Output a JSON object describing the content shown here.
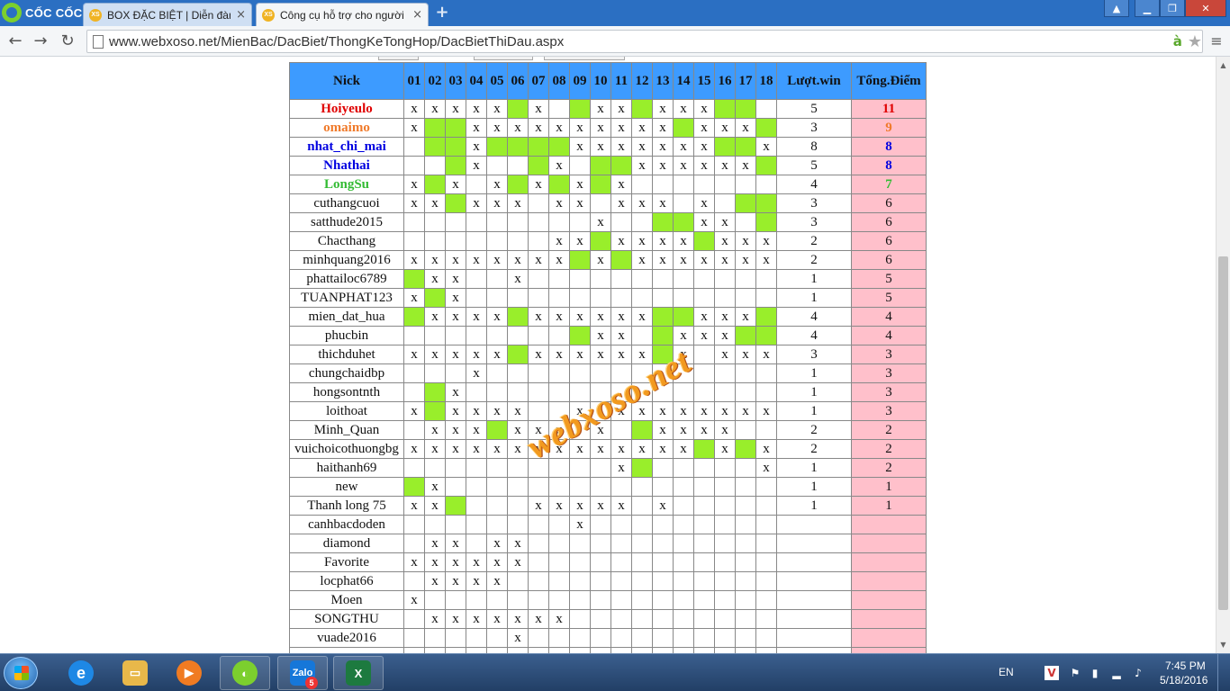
{
  "browser": {
    "brand": "CỐC CỐC",
    "tabs": [
      {
        "title": "BOX ĐẶC BIỆT | Diễn đàn x",
        "favicon": "XS"
      },
      {
        "title": "Công cụ hỗ trợ cho người",
        "favicon": "XS"
      }
    ],
    "url": "www.webxoso.net/MienBac/DacBiet/ThongKeTongHop/DacBietThiDau.aspx",
    "address_icons": {
      "ext": "à"
    }
  },
  "table": {
    "nick_header": "Nick",
    "day_headers": [
      "01",
      "02",
      "03",
      "04",
      "05",
      "06",
      "07",
      "08",
      "09",
      "10",
      "11",
      "12",
      "13",
      "14",
      "15",
      "16",
      "17",
      "18"
    ],
    "wins_header": "Lượt.win",
    "points_header": "Tổng.Điểm",
    "rows": [
      {
        "nick": "Hoiyeulo",
        "color": "#e00000",
        "days": "xxxxgxgxxgxxxgg",
        "wins": "5",
        "points": "11"
      },
      {
        "nick": "omaimo",
        "color": "#f07a2a",
        "days": "xggxxxxxxxxxgxxxg",
        "wins": "3",
        "points": "9"
      },
      {
        "nick": "nhat_chi_mai",
        "color": "#0000e0",
        "days": "gggxggggxxxxxxggggx",
        "wins": "8",
        "points": "8"
      },
      {
        "nick": "Nhathai",
        "color": "#0000e0",
        "days": "",
        "wins": "5",
        "points": "8"
      },
      {
        "nick": "LongSu",
        "color": "#33bb33",
        "days": "",
        "wins": "4",
        "points": "7"
      },
      {
        "nick": "cuthangcuoi",
        "color": "",
        "days": "",
        "wins": "3",
        "points": "6"
      },
      {
        "nick": "satthude2015",
        "color": "",
        "days": "",
        "wins": "3",
        "points": "6"
      },
      {
        "nick": "Chacthang",
        "color": "",
        "days": "",
        "wins": "2",
        "points": "6"
      },
      {
        "nick": "minhquang2016",
        "color": "",
        "days": "",
        "wins": "2",
        "points": "6"
      },
      {
        "nick": "phattailoc6789",
        "color": "",
        "days": "",
        "wins": "1",
        "points": "5"
      },
      {
        "nick": "TUANPHAT123",
        "color": "",
        "days": "",
        "wins": "1",
        "points": "5"
      },
      {
        "nick": "mien_dat_hua",
        "color": "",
        "days": "",
        "wins": "4",
        "points": "4"
      },
      {
        "nick": "phucbin",
        "color": "",
        "days": "",
        "wins": "4",
        "points": "4"
      },
      {
        "nick": "thichduhet",
        "color": "",
        "days": "",
        "wins": "3",
        "points": "3"
      },
      {
        "nick": "chungchaidbp",
        "color": "",
        "days": "",
        "wins": "1",
        "points": "3"
      },
      {
        "nick": "hongsontnth",
        "color": "",
        "days": "",
        "wins": "1",
        "points": "3"
      },
      {
        "nick": "loithoat",
        "color": "",
        "days": "",
        "wins": "1",
        "points": "3"
      },
      {
        "nick": "Minh_Quan",
        "color": "",
        "days": "",
        "wins": "2",
        "points": "2"
      },
      {
        "nick": "vuichoicothuongbg",
        "color": "",
        "days": "",
        "wins": "2",
        "points": "2"
      },
      {
        "nick": "haithanh69",
        "color": "",
        "days": "",
        "wins": "1",
        "points": "2"
      },
      {
        "nick": "new",
        "color": "",
        "days": "",
        "wins": "1",
        "points": "1"
      },
      {
        "nick": "Thanh long 75",
        "color": "",
        "days": "",
        "wins": "1",
        "points": "1"
      },
      {
        "nick": "canhbacdoden",
        "color": "",
        "days": "",
        "wins": "",
        "points": ""
      },
      {
        "nick": "diamond",
        "color": "",
        "days": "",
        "wins": "",
        "points": ""
      },
      {
        "nick": "Favorite",
        "color": "",
        "days": "",
        "wins": "",
        "points": ""
      },
      {
        "nick": "locphat66",
        "color": "",
        "days": "",
        "wins": "",
        "points": ""
      },
      {
        "nick": "Moen",
        "color": "",
        "days": "",
        "wins": "",
        "points": ""
      },
      {
        "nick": "SONGTHU",
        "color": "",
        "days": "",
        "wins": "",
        "points": ""
      },
      {
        "nick": "vuade2016",
        "color": "",
        "days": "",
        "wins": "",
        "points": ""
      }
    ],
    "cells": [
      [
        "x",
        "x",
        "x",
        "x",
        "x",
        "g",
        "x",
        "",
        "g",
        "x",
        "x",
        "g",
        "x",
        "x",
        "x",
        "g",
        "g",
        ""
      ],
      [
        "x",
        "g",
        "g",
        "x",
        "x",
        "x",
        "x",
        "x",
        "x",
        "x",
        "x",
        "x",
        "x",
        "g",
        "x",
        "x",
        "x",
        "g"
      ],
      [
        "",
        "g",
        "g",
        "x",
        "g",
        "g",
        "g",
        "g",
        "x",
        "x",
        "x",
        "x",
        "x",
        "x",
        "x",
        "g",
        "g",
        "x"
      ],
      [
        "",
        "",
        "g",
        "x",
        "",
        "",
        "g",
        "x",
        "",
        "g",
        "g",
        "x",
        "x",
        "x",
        "x",
        "x",
        "x",
        "g"
      ],
      [
        "x",
        "g",
        "x",
        "",
        "x",
        "g",
        "x",
        "g",
        "x",
        "g",
        "x",
        "",
        "",
        "",
        "",
        "",
        "",
        ""
      ],
      [
        "x",
        "x",
        "g",
        "x",
        "x",
        "x",
        "",
        "x",
        "x",
        "",
        "x",
        "x",
        "x",
        "",
        "x",
        "",
        "g",
        "g"
      ],
      [
        "",
        "",
        "",
        "",
        "",
        "",
        "",
        "",
        "",
        "x",
        "",
        "",
        "g",
        "g",
        "x",
        "x",
        "",
        "g"
      ],
      [
        "",
        "",
        "",
        "",
        "",
        "",
        "",
        "x",
        "x",
        "g",
        "x",
        "x",
        "x",
        "x",
        "g",
        "x",
        "x",
        "x"
      ],
      [
        "x",
        "x",
        "x",
        "x",
        "x",
        "x",
        "x",
        "x",
        "g",
        "x",
        "g",
        "x",
        "x",
        "x",
        "x",
        "x",
        "x",
        "x"
      ],
      [
        "g",
        "x",
        "x",
        "",
        "",
        "x",
        "",
        "",
        "",
        "",
        "",
        "",
        "",
        "",
        "",
        "",
        "",
        ""
      ],
      [
        "x",
        "g",
        "x",
        "",
        "",
        "",
        "",
        "",
        "",
        "",
        "",
        "",
        "",
        "",
        "",
        "",
        "",
        ""
      ],
      [
        "g",
        "x",
        "x",
        "x",
        "x",
        "g",
        "x",
        "x",
        "x",
        "x",
        "x",
        "x",
        "g",
        "g",
        "x",
        "x",
        "x",
        "g"
      ],
      [
        "",
        "",
        "",
        "",
        "",
        "",
        "",
        "",
        "g",
        "x",
        "x",
        "",
        "g",
        "x",
        "x",
        "x",
        "g",
        "g"
      ],
      [
        "x",
        "x",
        "x",
        "x",
        "x",
        "g",
        "x",
        "x",
        "x",
        "x",
        "x",
        "x",
        "g",
        "x",
        "",
        "x",
        "x",
        "x"
      ],
      [
        "",
        "",
        "",
        "x",
        "",
        "",
        "",
        "",
        "",
        "",
        "",
        "",
        "",
        "",
        "",
        "",
        "",
        ""
      ],
      [
        "",
        "g",
        "x",
        "",
        "",
        "",
        "",
        "",
        "",
        "",
        "",
        "",
        "",
        "",
        "",
        "",
        "",
        ""
      ],
      [
        "x",
        "g",
        "x",
        "x",
        "x",
        "x",
        "",
        "",
        "x",
        "",
        "x",
        "x",
        "x",
        "x",
        "x",
        "x",
        "x",
        "x"
      ],
      [
        "",
        "x",
        "x",
        "x",
        "g",
        "x",
        "x",
        "x",
        "",
        "x",
        "",
        "g",
        "x",
        "x",
        "x",
        "x",
        "",
        ""
      ],
      [
        "x",
        "x",
        "x",
        "x",
        "x",
        "x",
        "x",
        "x",
        "x",
        "x",
        "x",
        "x",
        "x",
        "x",
        "g",
        "x",
        "g",
        "x"
      ],
      [
        "",
        "",
        "",
        "",
        "",
        "",
        "",
        "",
        "",
        "",
        "x",
        "g",
        "",
        "",
        "",
        "",
        "",
        "x"
      ],
      [
        "g",
        "x",
        "",
        "",
        "",
        "",
        "",
        "",
        "",
        "",
        "",
        "",
        "",
        "",
        "",
        "",
        "",
        ""
      ],
      [
        "x",
        "x",
        "g",
        "",
        "",
        "",
        "x",
        "x",
        "x",
        "x",
        "x",
        "",
        "x",
        "",
        "",
        "",
        "",
        ""
      ],
      [
        "",
        "",
        "",
        "",
        "",
        "",
        "",
        "",
        "x",
        "",
        "",
        "",
        "",
        "",
        "",
        "",
        "",
        ""
      ],
      [
        "",
        "x",
        "x",
        "",
        "x",
        "x",
        "",
        "",
        "",
        "",
        "",
        "",
        "",
        "",
        "",
        "",
        "",
        ""
      ],
      [
        "x",
        "x",
        "x",
        "x",
        "x",
        "x",
        "",
        "",
        "",
        "",
        "",
        "",
        "",
        "",
        "",
        "",
        "",
        ""
      ],
      [
        "",
        "x",
        "x",
        "x",
        "x",
        "",
        "",
        "",
        "",
        "",
        "",
        "",
        "",
        "",
        "",
        "",
        "",
        ""
      ],
      [
        "x",
        "",
        "",
        "",
        "",
        "",
        "",
        "",
        "",
        "",
        "",
        "",
        "",
        "",
        "",
        "",
        "",
        ""
      ],
      [
        "",
        "x",
        "x",
        "x",
        "x",
        "x",
        "x",
        "x",
        "",
        "",
        "",
        "",
        "",
        "",
        "",
        "",
        "",
        ""
      ],
      [
        "",
        "",
        "",
        "",
        "",
        "x",
        "",
        "",
        "",
        "",
        "",
        "",
        "",
        "",
        "",
        "",
        "",
        ""
      ]
    ]
  },
  "watermark": "webxoso.net",
  "taskbar": {
    "zalo_badge": "5",
    "lang": "EN",
    "time": "7:45 PM",
    "date": "5/18/2016"
  },
  "colors": {
    "header_bg": "#3d9bff",
    "hit_bg": "#99ee2b",
    "score_bg": "#ffc0cb"
  }
}
